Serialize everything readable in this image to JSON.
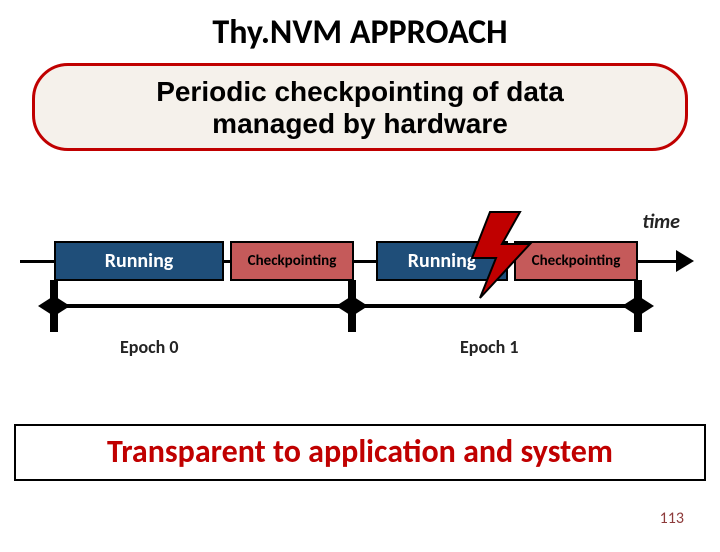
{
  "title": "Thy.NVM APPROACH",
  "subtitle": {
    "line1": "Periodic checkpointing of data",
    "line2": "managed by hardware"
  },
  "time_label": "time",
  "timeline": {
    "running1": "Running",
    "checkpoint1": "Checkpointing",
    "running2": "Running",
    "checkpoint2": "Checkpointing"
  },
  "epochs": {
    "e0": "Epoch 0",
    "e1": "Epoch 1"
  },
  "bottom_text": "Transparent to application and system",
  "page_number": "113",
  "colors": {
    "accent_red": "#c00000",
    "running_blue": "#1f4e79",
    "checkpoint_red": "#c55a5a"
  }
}
